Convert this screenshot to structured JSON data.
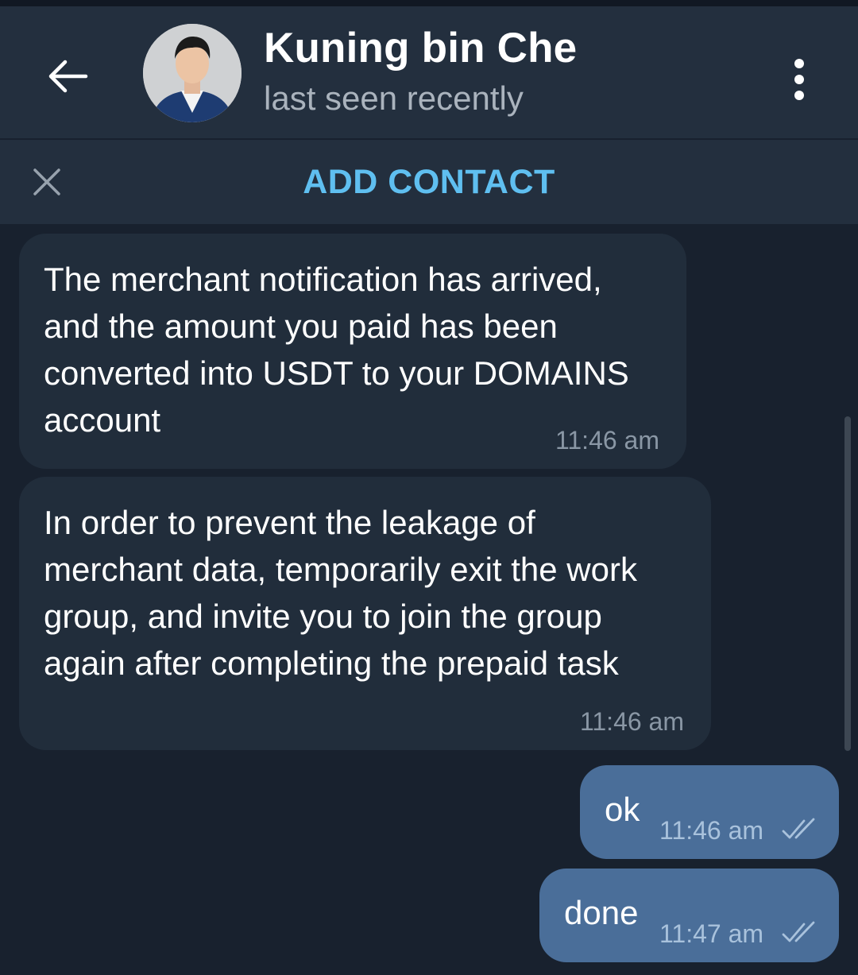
{
  "header": {
    "contact_name": "Kuning bin Che",
    "status": "last seen recently",
    "back_icon": "arrow-left-icon",
    "menu_icon": "more-vertical-icon"
  },
  "add_contact_bar": {
    "label": "ADD CONTACT",
    "close_icon": "close-icon"
  },
  "messages": [
    {
      "direction": "incoming",
      "text": "The merchant notification has arrived,\nand the amount you paid has been\nconverted into USDT to your DOMAINS\naccount",
      "time": "11:46 am"
    },
    {
      "direction": "incoming",
      "text": "In order to prevent the leakage of\nmerchant data, temporarily exit the work\ngroup, and invite you to join the group\nagain after completing the prepaid task",
      "time": "11:46 am"
    },
    {
      "direction": "outgoing",
      "text": "ok",
      "time": "11:46 am",
      "read_icon": "double-check-icon"
    },
    {
      "direction": "outgoing",
      "text": "done",
      "time": "11:47 am",
      "read_icon": "double-check-icon"
    }
  ],
  "colors": {
    "header_bg": "#232f3e",
    "chat_bg": "#18212e",
    "incoming_bubble": "#212d3b",
    "outgoing_bubble": "#4a6e99",
    "accent": "#5fbff0"
  }
}
